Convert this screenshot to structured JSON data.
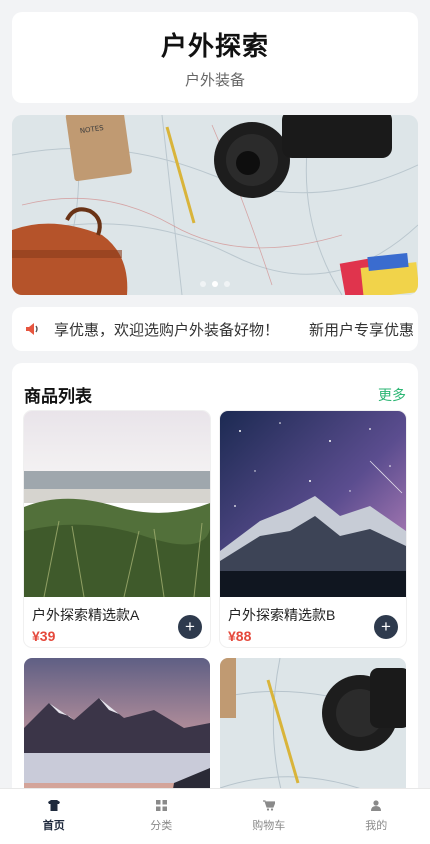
{
  "header": {
    "title": "户外探索",
    "subtitle": "户外装备"
  },
  "banner": {
    "image": "outdoor-gear-flatlay",
    "dot_count": 3,
    "active_dot": 1
  },
  "notice": {
    "icon": "speaker-icon",
    "text_part": "享优惠，欢迎选购户外装备好物！",
    "text_next": "新用户专享优惠"
  },
  "products": {
    "section_title": "商品列表",
    "more_label": "更多",
    "items": [
      {
        "name": "户外探索精选款A",
        "price": "¥39",
        "image": "beach-grass-photo"
      },
      {
        "name": "户外探索精选款B",
        "price": "¥88",
        "image": "mountain-milky-way-photo"
      },
      {
        "name": "",
        "price": "",
        "image": "snowy-mountains-sunset-photo"
      },
      {
        "name": "",
        "price": "",
        "image": "camera-map-photo"
      }
    ]
  },
  "tabbar": {
    "tabs": [
      {
        "label": "首页",
        "icon": "shirt-icon",
        "active": true
      },
      {
        "label": "分类",
        "icon": "grid-icon",
        "active": false
      },
      {
        "label": "购物车",
        "icon": "cart-icon",
        "active": false
      },
      {
        "label": "我的",
        "icon": "user-icon",
        "active": false
      }
    ]
  },
  "colors": {
    "accent": "#2bb673",
    "price": "#e5483b",
    "dark": "#2e3a4d"
  }
}
